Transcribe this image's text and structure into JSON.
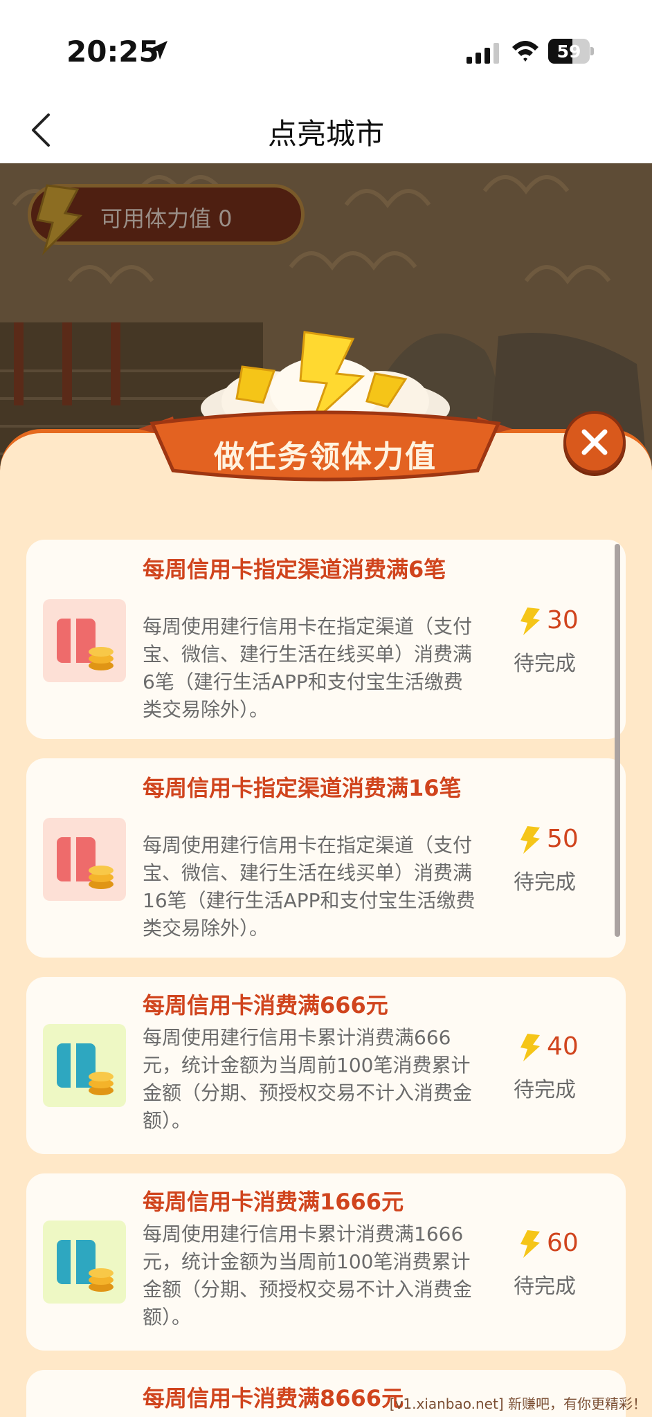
{
  "status_bar": {
    "time": "20:25",
    "battery": "59",
    "battery_level": 0.59
  },
  "nav": {
    "title": "点亮城市"
  },
  "stamina": {
    "label": "可用体力值 0"
  },
  "modal": {
    "title": "做任务领体力值"
  },
  "tasks": [
    {
      "title": "每周信用卡指定渠道消费满6笔",
      "desc": "每周使用建行信用卡在指定渠道（支付宝、微信、建行生活在线买单）消费满6笔（建行生活APP和支付宝生活缴费类交易除外）。",
      "reward": "30",
      "status": "待完成",
      "icon": "credit-card-coins-icon"
    },
    {
      "title": "每周信用卡指定渠道消费满16笔",
      "desc": "每周使用建行信用卡在指定渠道（支付宝、微信、建行生活在线买单）消费满16笔（建行生活APP和支付宝生活缴费类交易除外）。",
      "reward": "50",
      "status": "待完成",
      "icon": "credit-card-coins-icon"
    },
    {
      "title": "每周信用卡消费满666元",
      "desc": "每周使用建行信用卡累计消费满666元，统计金额为当周前100笔消费累计金额（分期、预授权交易不计入消费金额）。",
      "reward": "40",
      "status": "待完成",
      "icon": "credit-card-coins-icon"
    },
    {
      "title": "每周信用卡消费满1666元",
      "desc": "每周使用建行信用卡累计消费满1666元，统计金额为当周前100笔消费累计金额（分期、预授权交易不计入消费金额）。",
      "reward": "60",
      "status": "待完成",
      "icon": "credit-card-coins-icon"
    },
    {
      "title": "每周信用卡消费满8666元",
      "desc": "",
      "reward": "",
      "status": "",
      "icon": ""
    }
  ],
  "watermark": "[v1.xianbao.net] 新赚吧，有你更精彩！",
  "colors": {
    "accent": "#d0441d",
    "sheet": "#ffe8c8",
    "bolt": "#f5c518"
  }
}
